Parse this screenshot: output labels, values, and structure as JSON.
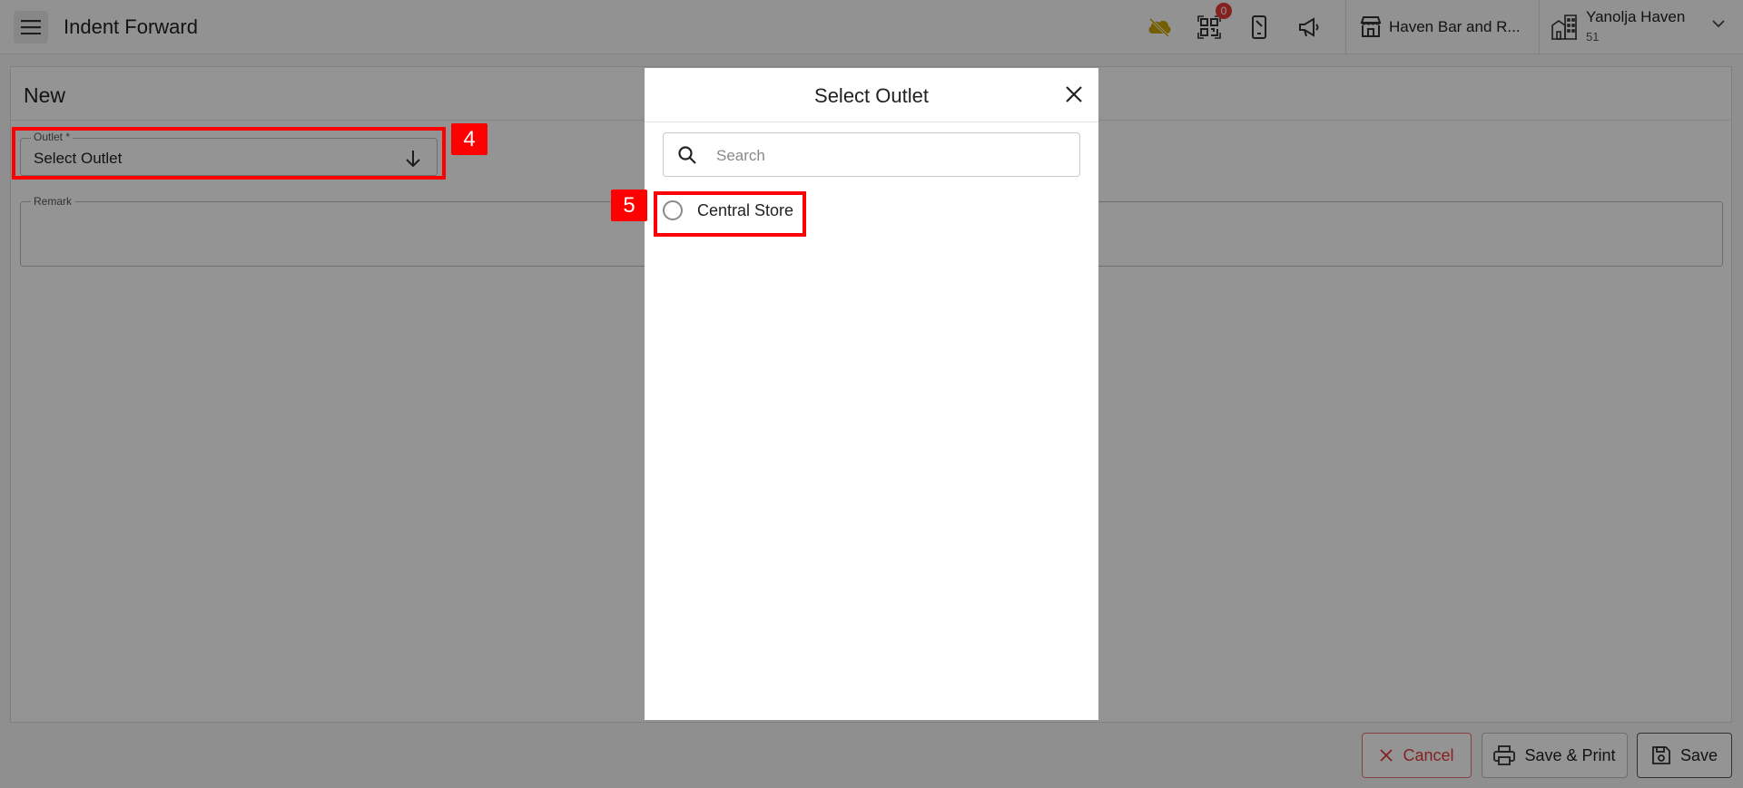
{
  "header": {
    "title": "Indent Forward",
    "notification_count": "0",
    "outlet_name": "Haven Bar and R...",
    "hotel_name": "Yanolja Haven",
    "hotel_id": "51",
    "icons": [
      "menu-icon",
      "cloud-off-icon",
      "qr-scan-icon",
      "mobile-icon",
      "megaphone-icon",
      "store-icon",
      "building-icon",
      "chevron-down-icon"
    ],
    "colors": {
      "cloud_icon": "#c9a400",
      "badge": "#e53935"
    }
  },
  "form": {
    "title": "New",
    "outlet_label": "Outlet *",
    "outlet_value": "Select Outlet",
    "remark_label": "Remark"
  },
  "footer": {
    "cancel_label": "Cancel",
    "save_print_label": "Save & Print",
    "save_label": "Save",
    "colors": {
      "cancel": "#e53935"
    }
  },
  "modal": {
    "title": "Select Outlet",
    "search_placeholder": "Search",
    "options": [
      {
        "label": "Central Store",
        "selected": false
      }
    ]
  },
  "annotations": [
    {
      "label": "4",
      "target": "outlet-field"
    },
    {
      "label": "5",
      "target": "option-central-store"
    }
  ],
  "annotation_color": "#ff0000"
}
